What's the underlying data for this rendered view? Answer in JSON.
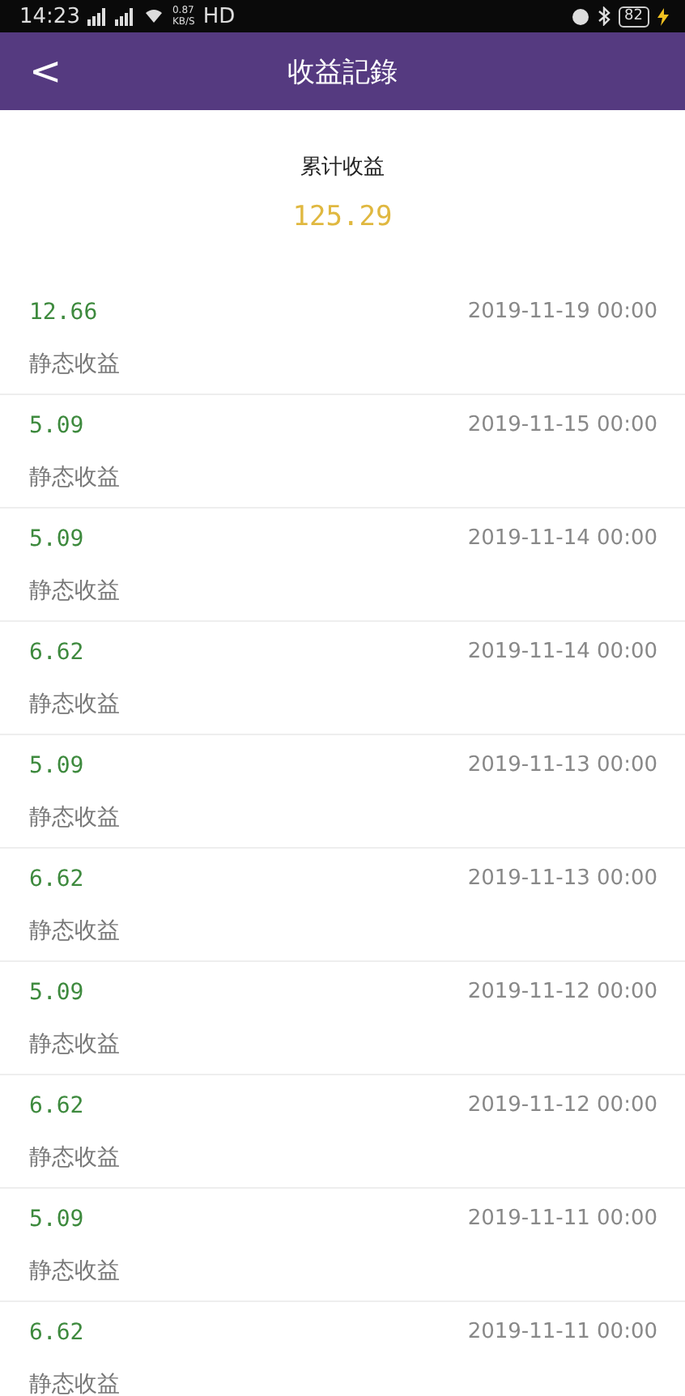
{
  "status_bar": {
    "time": "14:23",
    "net_speed": "0.87",
    "net_unit": "KB/S",
    "network_label": "HD",
    "battery": "82"
  },
  "header": {
    "back": "<",
    "title": "收益記錄"
  },
  "summary": {
    "label": "累计收益",
    "value": "125.29"
  },
  "records": [
    {
      "amount": "12.66",
      "date": "2019-11-19 00:00",
      "type": "静态收益"
    },
    {
      "amount": "5.09",
      "date": "2019-11-15 00:00",
      "type": "静态收益"
    },
    {
      "amount": "5.09",
      "date": "2019-11-14 00:00",
      "type": "静态收益"
    },
    {
      "amount": "6.62",
      "date": "2019-11-14 00:00",
      "type": "静态收益"
    },
    {
      "amount": "5.09",
      "date": "2019-11-13 00:00",
      "type": "静态收益"
    },
    {
      "amount": "6.62",
      "date": "2019-11-13 00:00",
      "type": "静态收益"
    },
    {
      "amount": "5.09",
      "date": "2019-11-12 00:00",
      "type": "静态收益"
    },
    {
      "amount": "6.62",
      "date": "2019-11-12 00:00",
      "type": "静态收益"
    },
    {
      "amount": "5.09",
      "date": "2019-11-11 00:00",
      "type": "静态收益"
    },
    {
      "amount": "6.62",
      "date": "2019-11-11 00:00",
      "type": "静态收益"
    }
  ]
}
